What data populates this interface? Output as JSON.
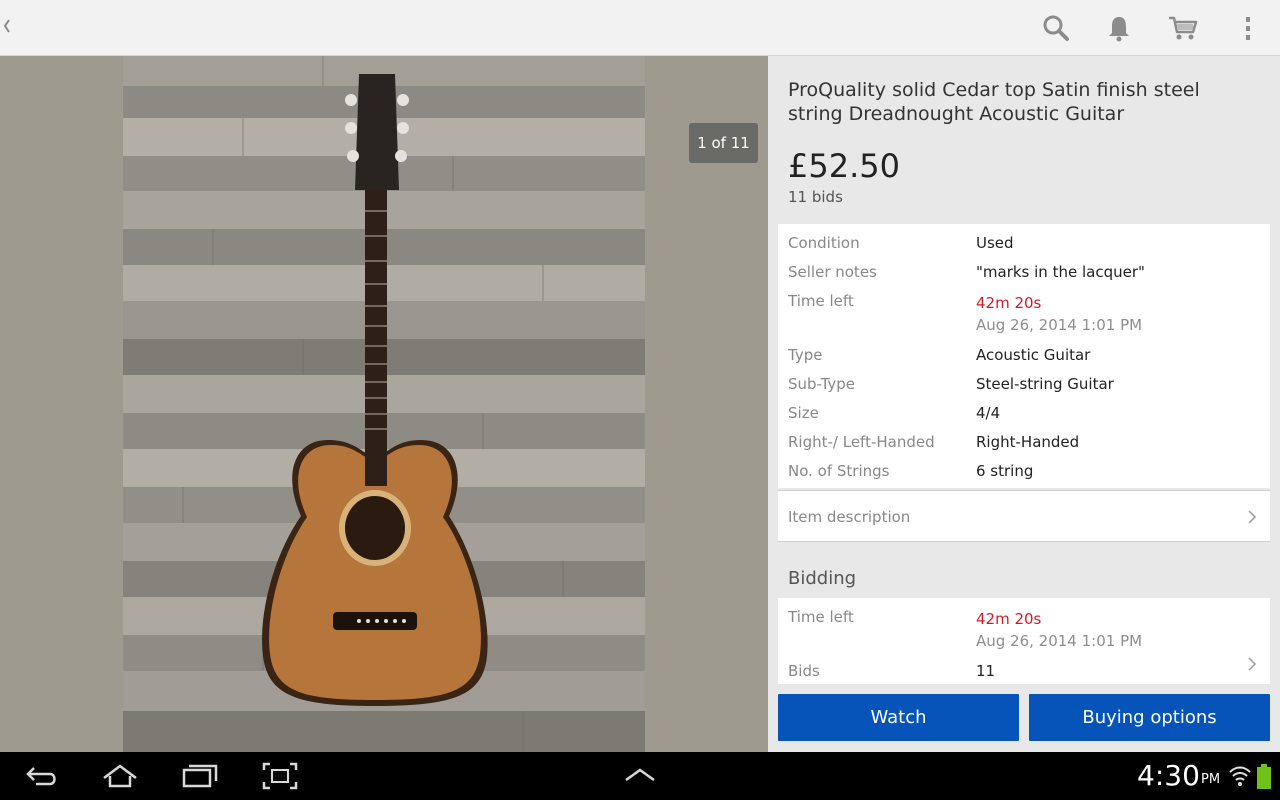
{
  "topbar": {
    "icons": [
      "chevron-left-icon",
      "search-icon",
      "bell-icon",
      "cart-icon",
      "overflow-menu-icon"
    ]
  },
  "gallery": {
    "counter": "1 of 11"
  },
  "listing": {
    "title": "ProQuality solid Cedar top Satin finish steel string Dreadnought Acoustic Guitar",
    "price": "£52.50",
    "bids_text": "11 bids"
  },
  "specs": [
    {
      "label": "Condition",
      "value": "Used"
    },
    {
      "label": "Seller notes",
      "value": "\"marks in the lacquer\""
    },
    {
      "label": "Time left",
      "value": "42m 20s",
      "sub": "Aug 26, 2014 1:01 PM"
    },
    {
      "label": "Type",
      "value": "Acoustic Guitar"
    },
    {
      "label": "Sub-Type",
      "value": "Steel-string Guitar"
    },
    {
      "label": "Size",
      "value": "4/4"
    },
    {
      "label": "Right-/ Left-Handed",
      "value": "Right-Handed"
    },
    {
      "label": "No. of Strings",
      "value": "6 string"
    }
  ],
  "description": {
    "label": "Item description"
  },
  "bidding": {
    "heading": "Bidding",
    "time_label": "Time left",
    "time_value": "42m 20s",
    "time_sub": "Aug 26, 2014 1:01 PM",
    "bids_label": "Bids",
    "bids_value": "11"
  },
  "actions": {
    "watch": "Watch",
    "buy": "Buying options"
  },
  "system": {
    "time": "4:30",
    "ampm": "PM"
  },
  "colors": {
    "accent": "#0654ba",
    "urgent": "#d0192f"
  }
}
